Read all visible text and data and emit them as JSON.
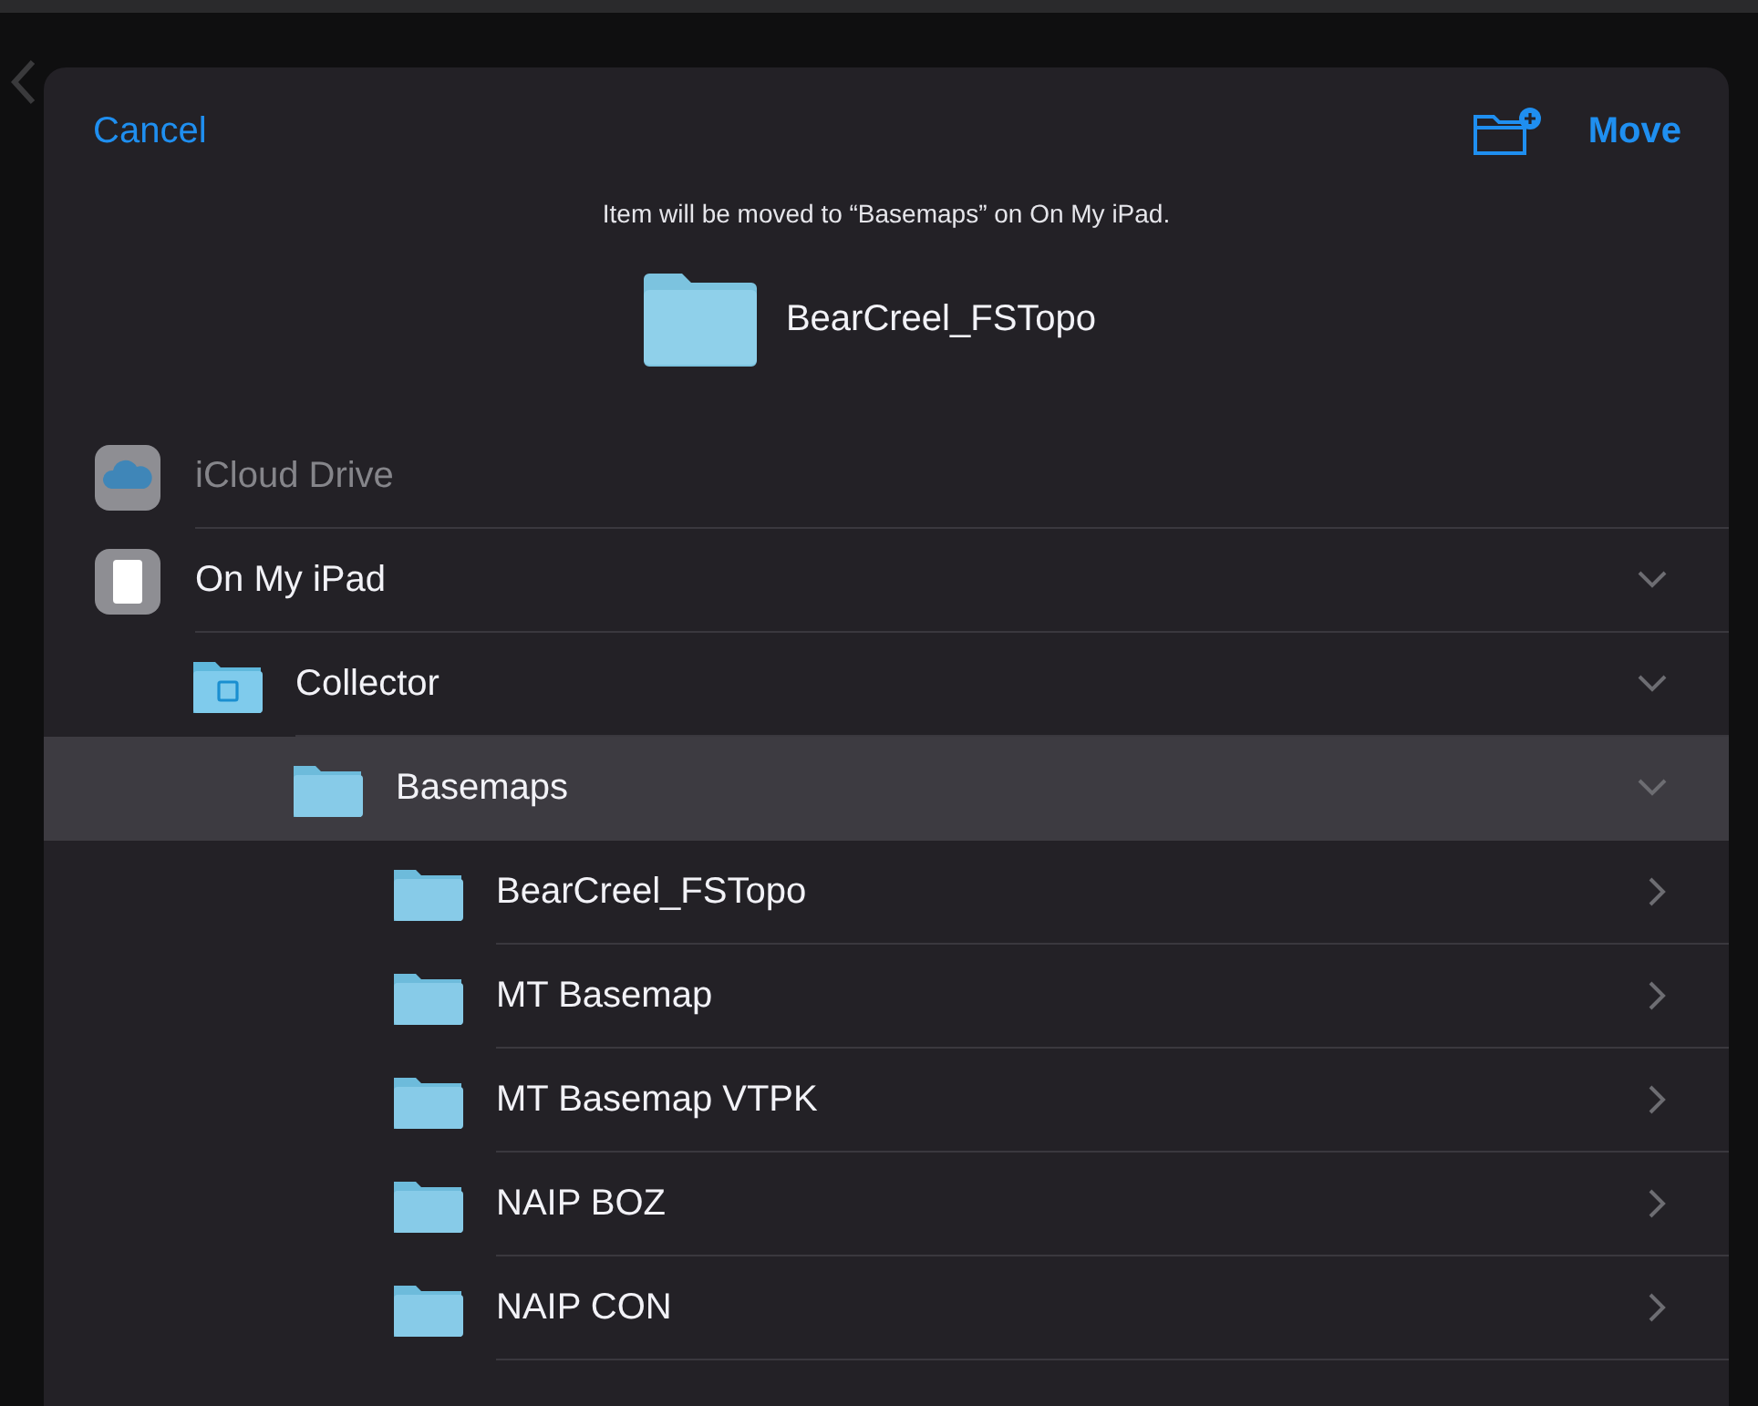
{
  "header": {
    "cancel": "Cancel",
    "confirm": "Move"
  },
  "message": "Item will be moved to “Basemaps” on On My iPad.",
  "item": {
    "name": "BearCreel_FSTopo"
  },
  "locations": [
    {
      "kind": "icloud",
      "label": "iCloud Drive",
      "disabled": true,
      "selected": false
    },
    {
      "kind": "device",
      "label": "On My iPad",
      "disabled": false,
      "selected": false,
      "expanded": true,
      "children": [
        {
          "kind": "app-folder",
          "label": "Collector",
          "disabled": false,
          "selected": false,
          "expanded": true,
          "children": [
            {
              "kind": "folder",
              "label": "Basemaps",
              "disabled": false,
              "selected": true,
              "expanded": true,
              "children": [
                {
                  "kind": "folder",
                  "label": "BearCreel_FSTopo",
                  "disabled": false,
                  "selected": false,
                  "expanded": false
                },
                {
                  "kind": "folder",
                  "label": "MT Basemap",
                  "disabled": false,
                  "selected": false,
                  "expanded": false
                },
                {
                  "kind": "folder",
                  "label": "MT Basemap VTPK",
                  "disabled": false,
                  "selected": false,
                  "expanded": false
                },
                {
                  "kind": "folder",
                  "label": "NAIP BOZ",
                  "disabled": false,
                  "selected": false,
                  "expanded": false
                },
                {
                  "kind": "folder",
                  "label": "NAIP CON",
                  "disabled": false,
                  "selected": false,
                  "expanded": false
                }
              ]
            }
          ]
        }
      ]
    }
  ]
}
